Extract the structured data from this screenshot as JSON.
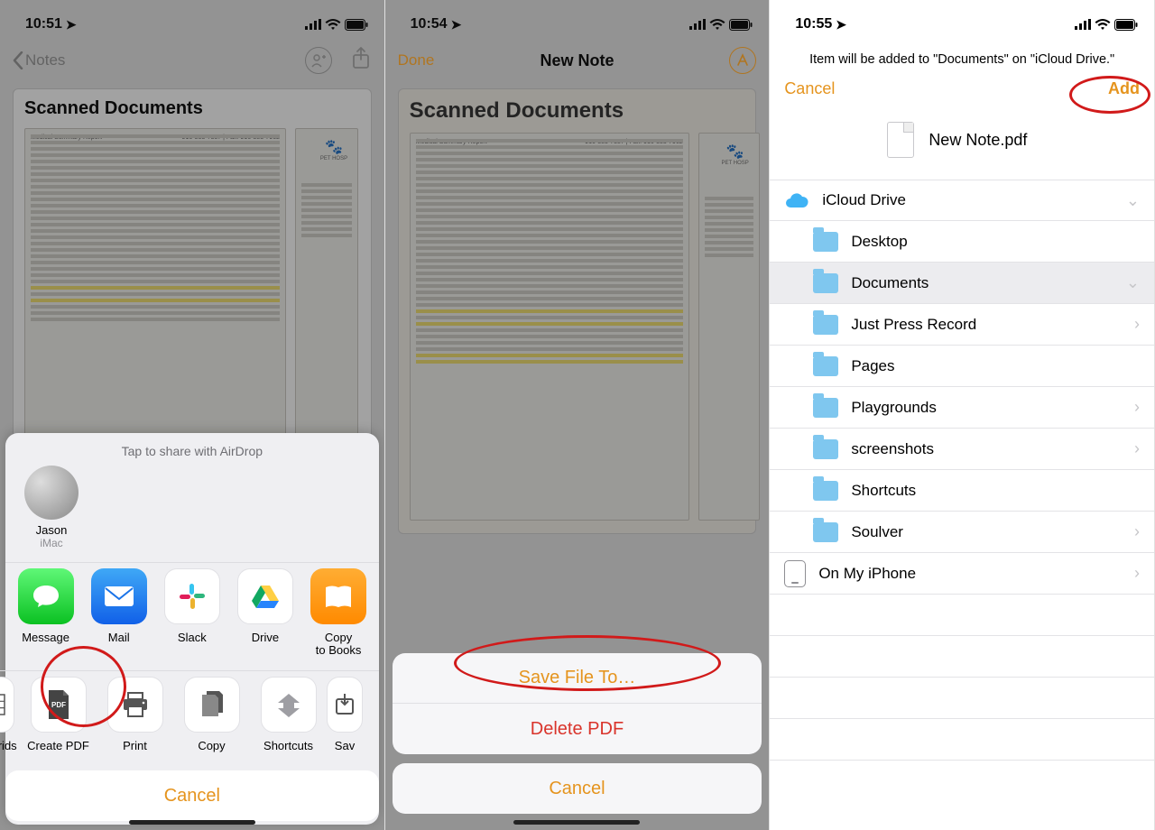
{
  "phone1": {
    "time": "10:51",
    "back_label": "Notes",
    "note_title": "Scanned Documents",
    "doc_header_left": "Medical Summary Report",
    "doc_header_right": "916-383-7387 | Fax: 916-383-7962",
    "vet_name": "PET HOSP",
    "airdrop_hint": "Tap to share with AirDrop",
    "airdrop": {
      "name": "Jason",
      "device": "iMac"
    },
    "apps": [
      {
        "label": "Message"
      },
      {
        "label": "Mail"
      },
      {
        "label": "Slack"
      },
      {
        "label": "Drive"
      },
      {
        "label": "Copy\nto Books"
      }
    ],
    "actions": [
      {
        "label": "& Grids"
      },
      {
        "label": "Create PDF"
      },
      {
        "label": "Print"
      },
      {
        "label": "Copy"
      },
      {
        "label": "Shortcuts"
      },
      {
        "label": "Sav"
      }
    ],
    "cancel": "Cancel"
  },
  "phone2": {
    "time": "10:54",
    "done": "Done",
    "title": "New Note",
    "note_title": "Scanned Documents",
    "doc_header_left": "Medical Summary Report",
    "doc_header_right": "916-383-7387 | Fax: 916-383-7962",
    "vet_name": "PET HOSP",
    "save": "Save File To…",
    "delete": "Delete PDF",
    "cancel": "Cancel"
  },
  "phone3": {
    "time": "10:55",
    "info": "Item will be added to \"Documents\" on \"iCloud Drive.\"",
    "cancel": "Cancel",
    "add": "Add",
    "filename": "New Note.pdf",
    "root": "iCloud Drive",
    "folders": [
      "Desktop",
      "Documents",
      "Just Press Record",
      "Pages",
      "Playgrounds",
      "screenshots",
      "Shortcuts",
      "Soulver"
    ],
    "local": "On My iPhone"
  }
}
